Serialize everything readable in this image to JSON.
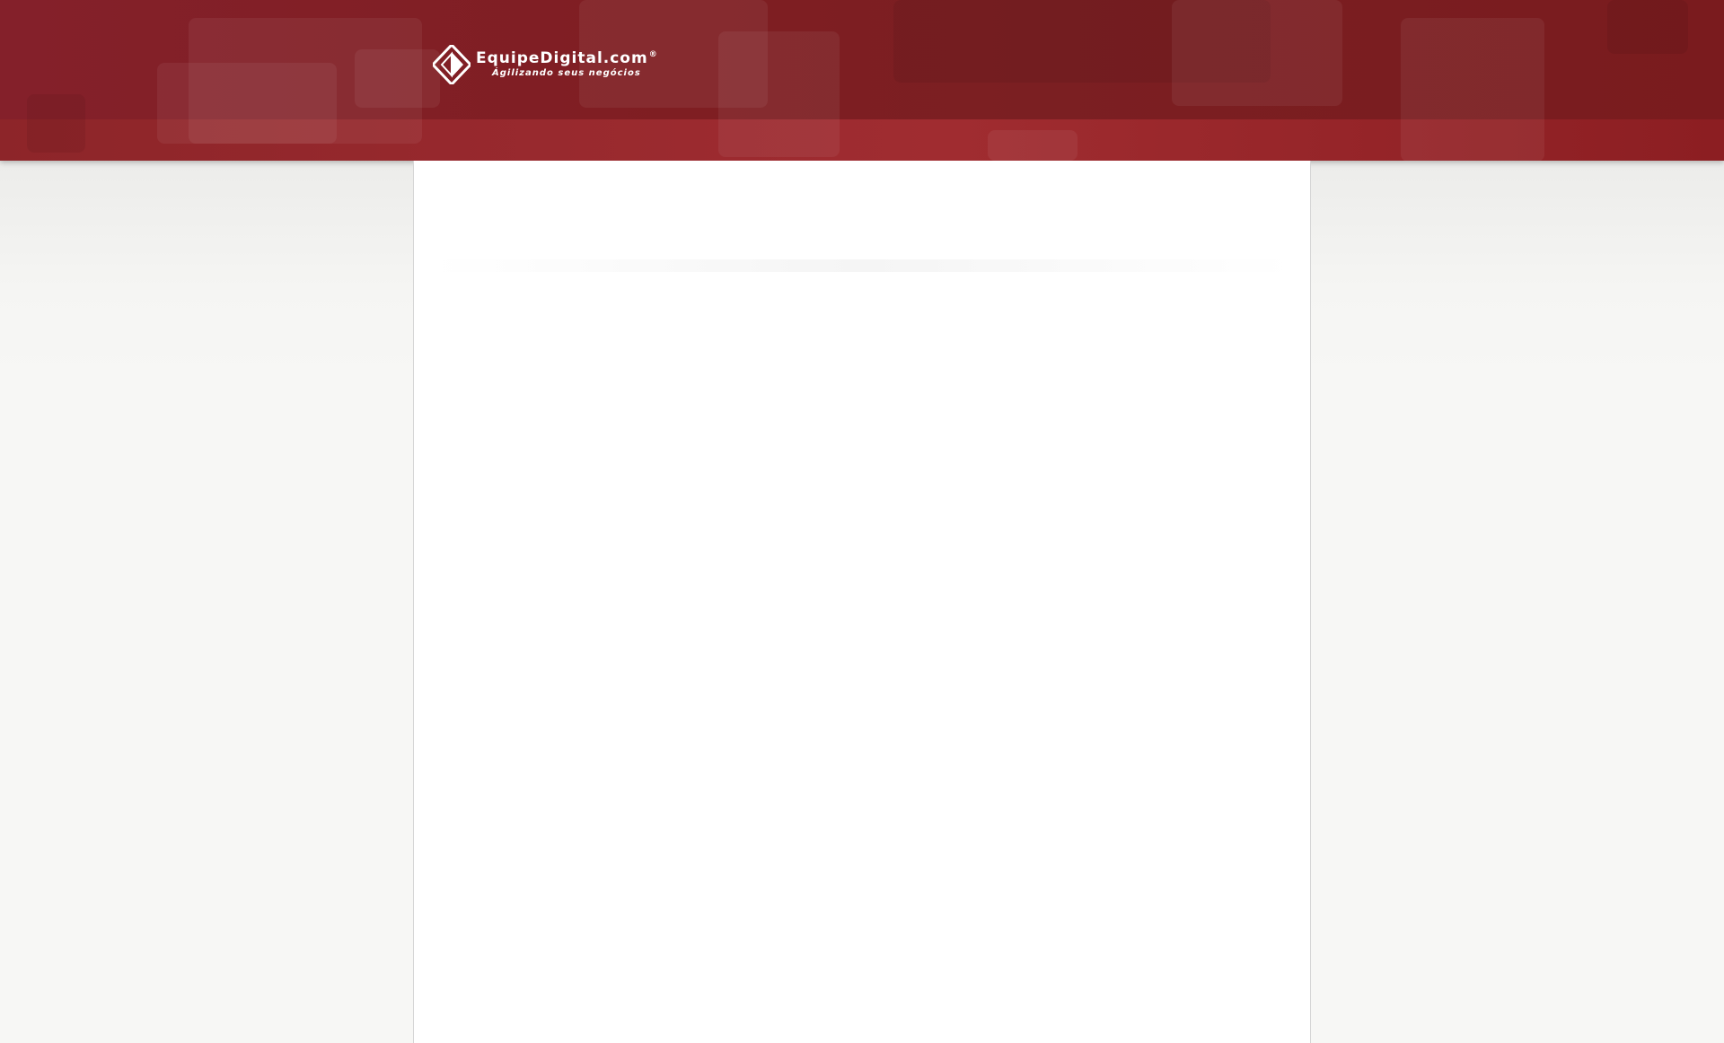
{
  "brand": {
    "name": "EquipeDigital.com",
    "registered_mark": "®",
    "tagline": "Ágilizando seus negócios",
    "logo_icon": "equipedigital-logo-icon"
  },
  "colors": {
    "header": "#7f1e22",
    "header_band": "#9b2a2f",
    "page_background": "#f7f7f5",
    "content_background": "#ffffff"
  }
}
